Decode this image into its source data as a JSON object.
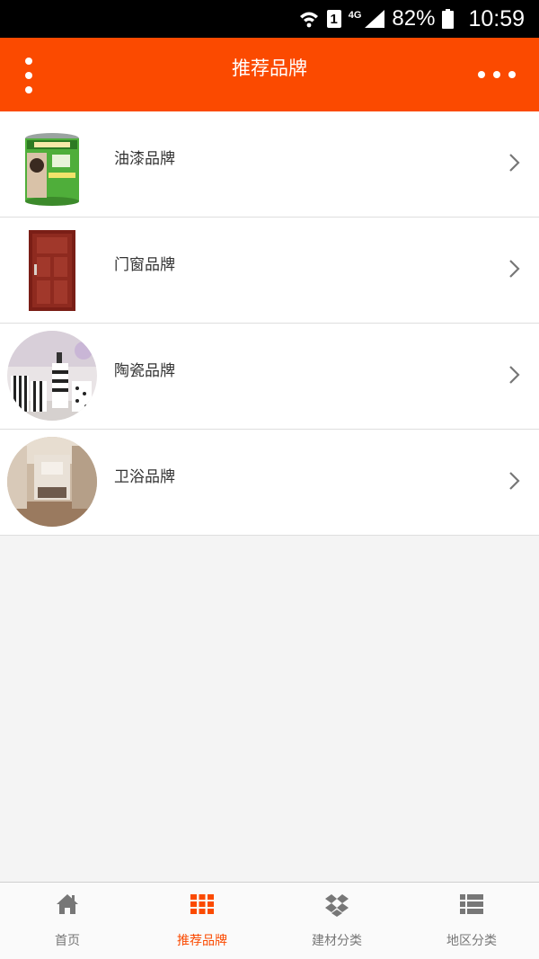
{
  "status_bar": {
    "sim_slot": "1",
    "network": "4G",
    "battery": "82%",
    "time": "10:59"
  },
  "header": {
    "title": "推荐品牌"
  },
  "brands": [
    {
      "label": "油漆品牌",
      "image": "paint-bucket"
    },
    {
      "label": "门窗品牌",
      "image": "door"
    },
    {
      "label": "陶瓷品牌",
      "image": "ceramics"
    },
    {
      "label": "卫浴品牌",
      "image": "bathroom"
    }
  ],
  "tabbar": {
    "items": [
      {
        "label": "首页",
        "icon": "home-icon",
        "active": false
      },
      {
        "label": "推荐品牌",
        "icon": "grid-icon",
        "active": true
      },
      {
        "label": "建材分类",
        "icon": "dropbox-icon",
        "active": false
      },
      {
        "label": "地区分类",
        "icon": "list-icon",
        "active": false
      }
    ]
  },
  "colors": {
    "accent": "#fb4a00",
    "background": "#f4f4f4",
    "inactive_tab": "#777777"
  }
}
